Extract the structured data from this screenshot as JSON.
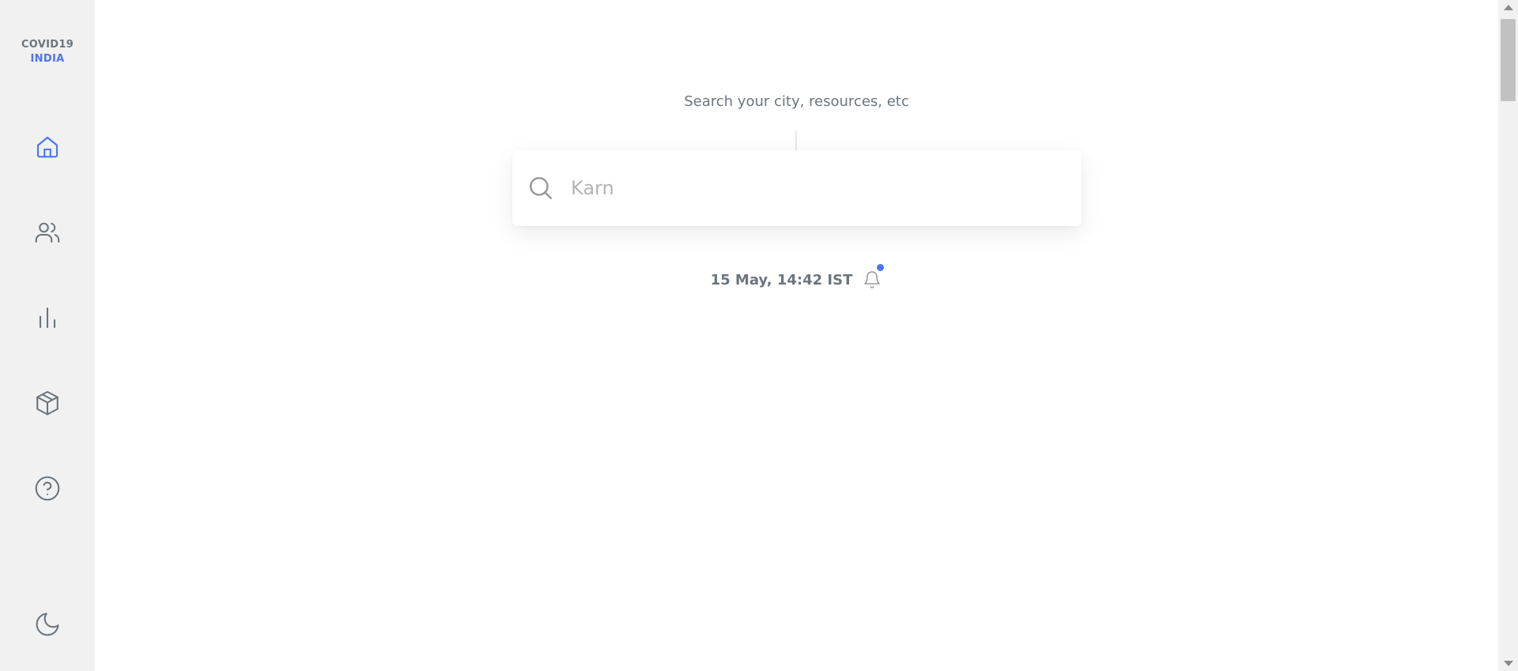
{
  "logo": {
    "line1": "COVID19",
    "line2": "INDIA"
  },
  "sidebar": {
    "items": [
      {
        "icon": "home-icon",
        "active": true
      },
      {
        "icon": "users-icon",
        "active": false
      },
      {
        "icon": "bar-chart-icon",
        "active": false
      },
      {
        "icon": "package-icon",
        "active": false
      },
      {
        "icon": "help-circle-icon",
        "active": false
      }
    ],
    "theme_toggle_icon": "moon-icon"
  },
  "search": {
    "hint": "Search your city, resources, etc",
    "placeholder": "Karn",
    "value": ""
  },
  "last_updated": {
    "text": "15 May, 14:42 IST",
    "has_notification": true
  },
  "colors": {
    "accent": "#4c75f2",
    "text_muted": "#6c757d",
    "sidebar_bg": "#f1f1f1"
  }
}
